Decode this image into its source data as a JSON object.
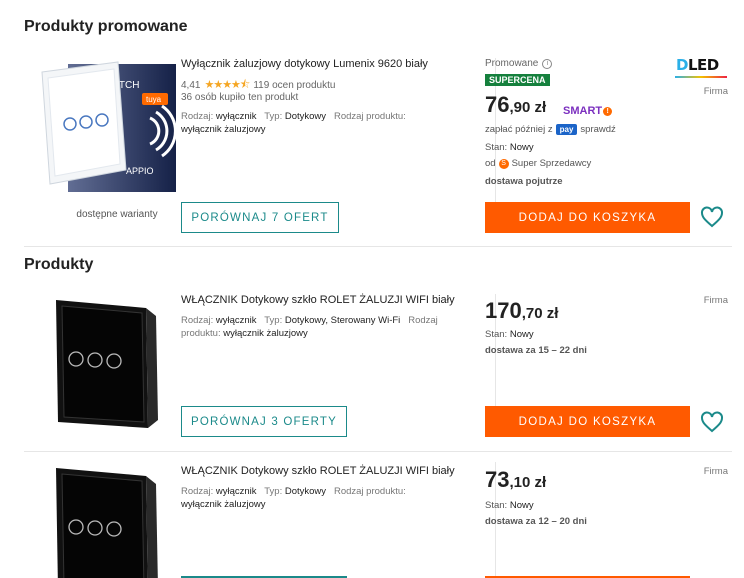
{
  "promoted_section": {
    "title": "Produkty promowane"
  },
  "products_section": {
    "title": "Produkty"
  },
  "promoted": {
    "title": "Wyłącznik żaluzjowy dotykowy Lumenix 9620 biały",
    "rating_value": "4,41",
    "rating_stars": 4.41,
    "rating_count": "119 ocen produktu",
    "bought": "36 osób kupiło ten produkt",
    "param1_label": "Rodzaj:",
    "param1_value": "wyłącznik",
    "param2_label": "Typ:",
    "param2_value": "Dotykowy",
    "param3_label": "Rodzaj produktu:",
    "param3_value": "wyłącznik żaluzjowy",
    "variants": "dostępne warianty",
    "image_text_brand": "SWITCH",
    "image_text_tag": "tuya",
    "image_text_logo": "APPIO",
    "compare": "PORÓWNAJ 7 OFERT",
    "promo_label": "Promowane",
    "supercena": "SUPERCENA",
    "price_main": "76",
    "price_cents": ",90 zł",
    "smart": "SMART",
    "pay_prefix": "zapłać później z",
    "pay_badge": "pay",
    "pay_suffix": "sprawdź",
    "state_label": "Stan:",
    "state_value": "Nowy",
    "seller_prefix": "od",
    "seller_name": "Super Sprzedawcy",
    "delivery": "dostawa pojutrze",
    "add_to_cart": "DODAJ DO KOSZYKA",
    "brand_logo": "LED",
    "brand_logo_d": "D",
    "firma": "Firma"
  },
  "products": [
    {
      "title": "WŁĄCZNIK Dotykowy szkło ROLET ŻALUZJI WIFI biały",
      "param1_label": "Rodzaj:",
      "param1_value": "wyłącznik",
      "param2_label": "Typ:",
      "param2_value": "Dotykowy, Sterowany Wi-Fi",
      "param3_label": "Rodzaj produktu:",
      "param3_value": "wyłącznik żaluzjowy",
      "compare": "PORÓWNAJ 3 OFERTY",
      "price_main": "170",
      "price_cents": ",70 zł",
      "state_label": "Stan:",
      "state_value": "Nowy",
      "delivery": "dostawa za 15 – 22 dni",
      "add_to_cart": "DODAJ DO KOSZYKA",
      "firma": "Firma"
    },
    {
      "title": "WŁĄCZNIK Dotykowy szkło ROLET ŻALUZJI WIFI biały",
      "param1_label": "Rodzaj:",
      "param1_value": "wyłącznik",
      "param2_label": "Typ:",
      "param2_value": "Dotykowy",
      "param3_label": "Rodzaj produktu:",
      "param3_value": "wyłącznik żaluzjowy",
      "price_main": "73",
      "price_cents": ",10 zł",
      "state_label": "Stan:",
      "state_value": "Nowy",
      "delivery": "dostawa za 12 – 20 dni",
      "firma": "Firma"
    }
  ],
  "colors": {
    "accent_orange": "#ff5a00",
    "teal": "#1b8a8a",
    "supercena_green": "#15803d",
    "star": "#f5a623"
  }
}
